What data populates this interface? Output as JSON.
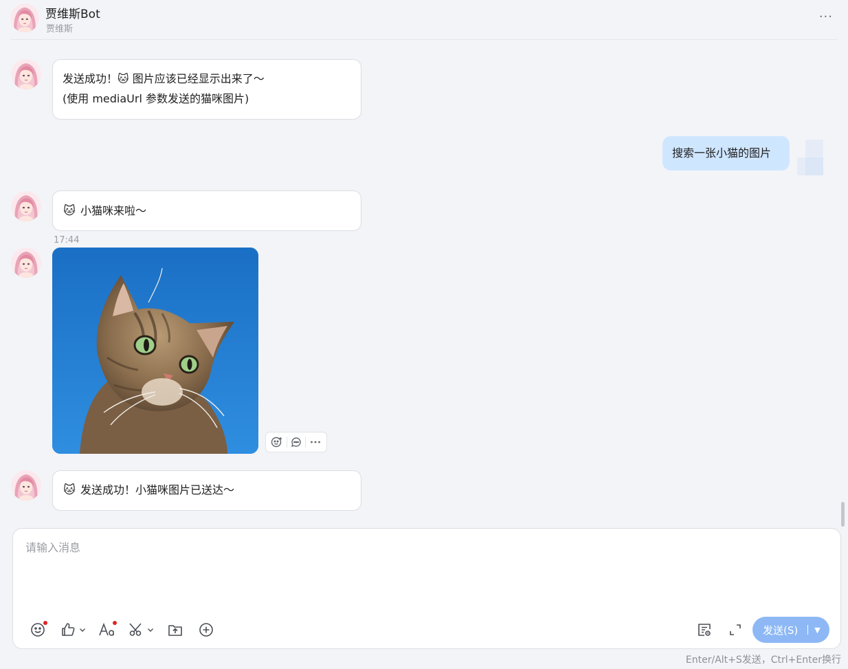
{
  "header": {
    "title": "贾维斯Bot",
    "subtitle": "贾维斯",
    "more_glyph": "···"
  },
  "messages": [
    {
      "from": "bot",
      "lines": [
        "发送成功！🐱 图片应该已经显示出来了～",
        "(使用 mediaUrl 参数发送的猫咪图片)"
      ]
    },
    {
      "from": "user",
      "text": "搜索一张小猫的图片"
    },
    {
      "from": "bot",
      "emoji": "🐱",
      "text": "小猫咪来啦～"
    },
    {
      "from": "bot",
      "type": "image",
      "timestamp": "17:44",
      "image_description_icon": "cat-photo"
    },
    {
      "from": "bot",
      "emoji": "🐱",
      "text": "发送成功！小猫咪图片已送达～"
    }
  ],
  "image_actions": [
    "add-reaction-icon",
    "reply-icon",
    "more-icon"
  ],
  "composer": {
    "placeholder": "请输入消息",
    "send_label": "发送(S)",
    "hint": "Enter/Alt+S发送，Ctrl+Enter换行"
  },
  "toolbar": [
    "emoji-icon",
    "thumbs-up-icon",
    "font-icon",
    "scissors-icon",
    "upload-icon",
    "plus-circle-icon",
    "notes-icon",
    "expand-icon"
  ],
  "colors": {
    "background": "#f3f4f8",
    "user_bubble": "#cfe6ff",
    "send_button": "#8db8f5",
    "notification_dot": "#e02424"
  }
}
